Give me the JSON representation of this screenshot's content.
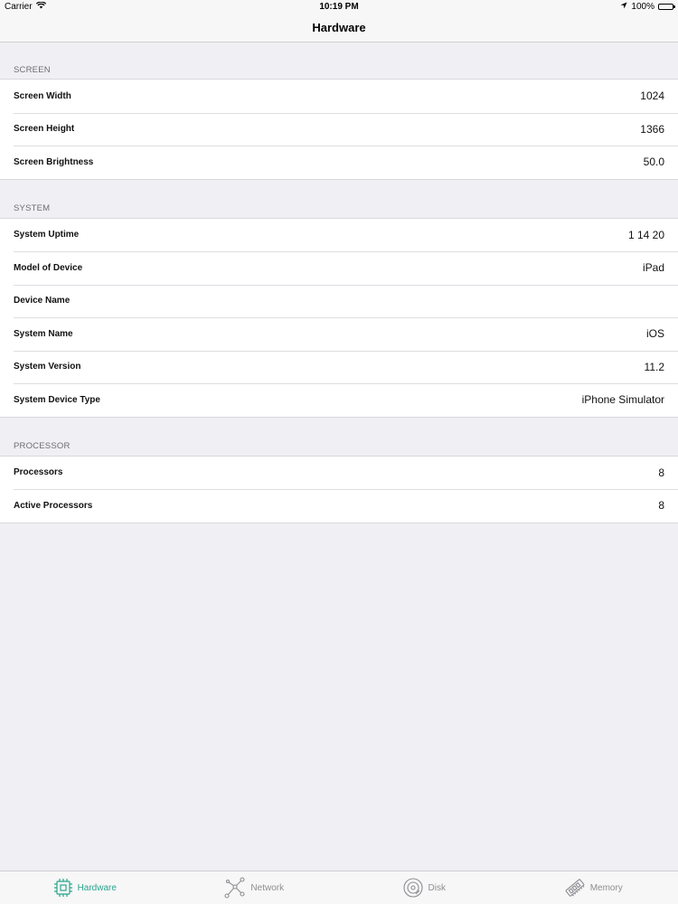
{
  "status_bar": {
    "carrier": "Carrier",
    "time": "10:19 PM",
    "battery": "100%",
    "battery_level": 1.0
  },
  "nav": {
    "title": "Hardware"
  },
  "sections": {
    "screen": {
      "header": "SCREEN",
      "rows": [
        {
          "label": "Screen Width",
          "value": "1024"
        },
        {
          "label": "Screen Height",
          "value": "1366"
        },
        {
          "label": "Screen Brightness",
          "value": "50.0"
        }
      ]
    },
    "system": {
      "header": "SYSTEM",
      "rows": [
        {
          "label": "System Uptime",
          "value": "1 14 20"
        },
        {
          "label": "Model of Device",
          "value": "iPad"
        },
        {
          "label": "Device Name",
          "value": ""
        },
        {
          "label": "System Name",
          "value": "iOS"
        },
        {
          "label": "System Version",
          "value": "11.2"
        },
        {
          "label": "System Device Type",
          "value": "iPhone Simulator"
        }
      ]
    },
    "processor": {
      "header": "PROCESSOR",
      "rows": [
        {
          "label": "Processors",
          "value": "8"
        },
        {
          "label": "Active Processors",
          "value": "8"
        }
      ]
    }
  },
  "tab_bar": {
    "tabs": [
      {
        "label": "Hardware",
        "icon": "chip-icon",
        "active": true
      },
      {
        "label": "Network",
        "icon": "network-icon",
        "active": false
      },
      {
        "label": "Disk",
        "icon": "disk-icon",
        "active": false
      },
      {
        "label": "Memory",
        "icon": "memory-icon",
        "active": false
      }
    ]
  },
  "colors": {
    "accent": "#2aa58c",
    "inactive": "#8e8e93",
    "background": "#efeff4"
  }
}
